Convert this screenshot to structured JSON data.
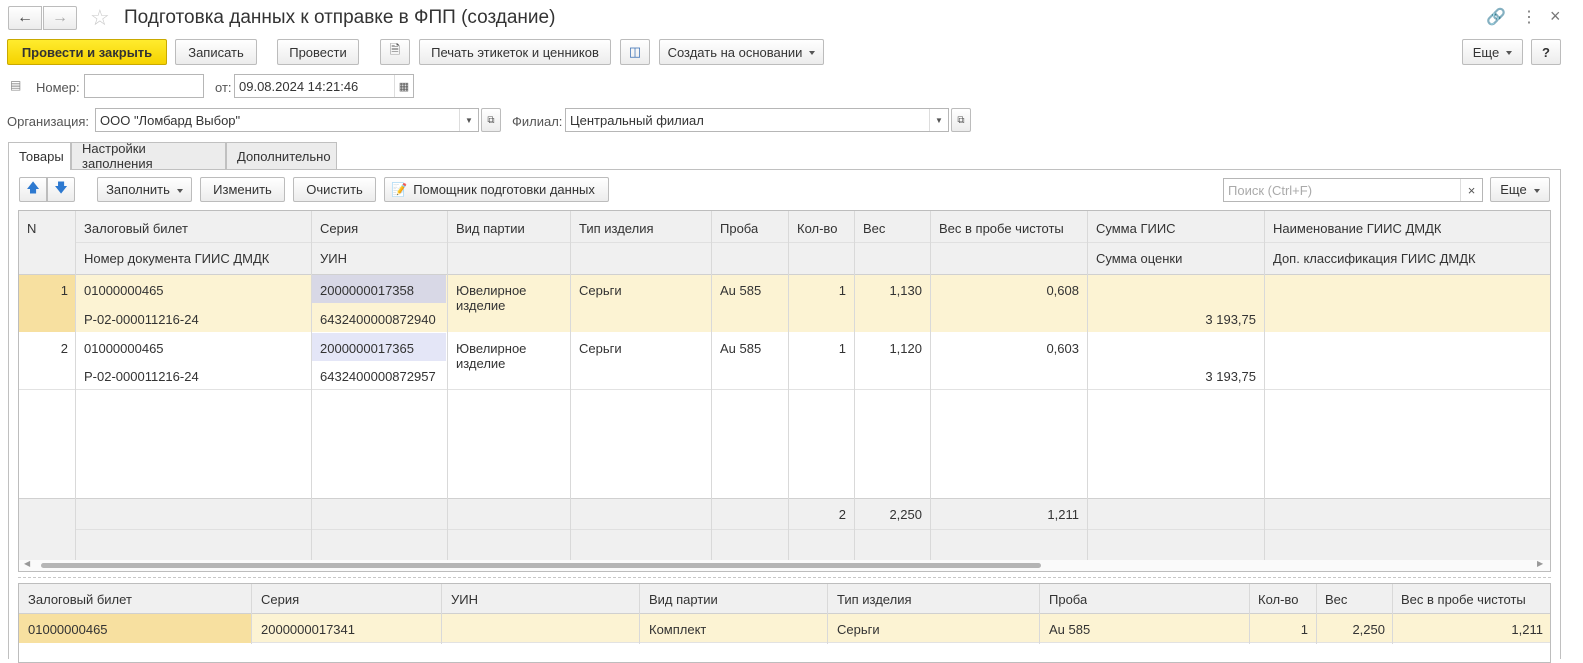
{
  "window": {
    "title": "Подготовка данных к отправке в ФПП (создание)"
  },
  "toolbar": {
    "post_close": "Провести и закрыть",
    "save": "Записать",
    "post": "Провести",
    "print": "Печать этикеток и ценников",
    "create_based": "Создать на основании",
    "more": "Еще",
    "help": "?"
  },
  "header": {
    "number_label": "Номер:",
    "number_value": "",
    "from_label": "от:",
    "date_value": "09.08.2024 14:21:46",
    "org_label": "Организация:",
    "org_value": "ООО \"Ломбард Выбор\"",
    "branch_label": "Филиал:",
    "branch_value": "Центральный филиал"
  },
  "tabs": [
    "Товары",
    "Настройки заполнения",
    "Дополнительно"
  ],
  "tab_toolbar": {
    "fill": "Заполнить",
    "change": "Изменить",
    "clear": "Очистить",
    "helper": "Помощник подготовки данных",
    "search_placeholder": "Поиск (Ctrl+F)",
    "more": "Еще"
  },
  "table": {
    "headers": {
      "n": "N",
      "ticket": "Залоговый билет",
      "doc": "Номер документа ГИИС ДМДК",
      "series": "Серия",
      "uin": "УИН",
      "batch": "Вид партии",
      "type": "Тип изделия",
      "probe": "Проба",
      "qty": "Кол-во",
      "weight": "Вес",
      "pure": "Вес в пробе чистоты",
      "sum_giis": "Сумма ГИИС",
      "sum_est": "Сумма оценки",
      "name_giis": "Наименование ГИИС ДМДК",
      "class_giis": "Доп. классификация ГИИС ДМДК"
    },
    "rows": [
      {
        "n": "1",
        "ticket": "01000000465",
        "doc": "Р-02-000011216-24",
        "series": "2000000017358",
        "uin": "6432400000872940",
        "batch": "Ювелирное изделие",
        "type": "Серьги",
        "probe": "Au 585",
        "qty": "1",
        "weight": "1,130",
        "pure": "0,608",
        "sum_giis": "",
        "sum_est": "3 193,75",
        "name_giis": "",
        "class_giis": ""
      },
      {
        "n": "2",
        "ticket": "01000000465",
        "doc": "Р-02-000011216-24",
        "series": "2000000017365",
        "uin": "6432400000872957",
        "batch": "Ювелирное изделие",
        "type": "Серьги",
        "probe": "Au 585",
        "qty": "1",
        "weight": "1,120",
        "pure": "0,603",
        "sum_giis": "",
        "sum_est": "3 193,75",
        "name_giis": "",
        "class_giis": ""
      }
    ],
    "totals": {
      "qty": "2",
      "weight": "2,250",
      "pure": "1,211"
    }
  },
  "lower_table": {
    "headers": {
      "ticket": "Залоговый билет",
      "series": "Серия",
      "uin": "УИН",
      "batch": "Вид партии",
      "type": "Тип изделия",
      "probe": "Проба",
      "qty": "Кол-во",
      "weight": "Вес",
      "pure": "Вес в пробе чистоты"
    },
    "rows": [
      {
        "ticket": "01000000465",
        "series": "2000000017341",
        "uin": "",
        "batch": "Комплект",
        "type": "Серьги",
        "probe": "Au 585",
        "qty": "1",
        "weight": "2,250",
        "pure": "1,211"
      }
    ]
  }
}
